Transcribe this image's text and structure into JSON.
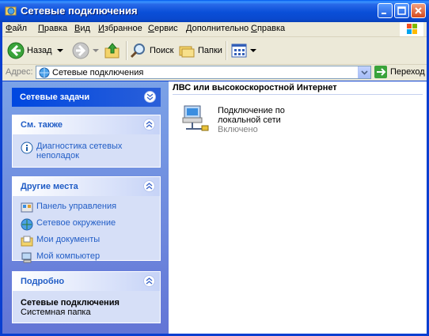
{
  "window": {
    "title": "Сетевые подключения"
  },
  "menu": [
    "Файл",
    "Правка",
    "Вид",
    "Избранное",
    "Сервис",
    "Дополнительно",
    "Справка"
  ],
  "toolbar": {
    "back": "Назад",
    "search": "Поиск",
    "folders": "Папки"
  },
  "address": {
    "label": "Адрес:",
    "value": "Сетевые подключения",
    "go": "Переход"
  },
  "tasks": {
    "network_tasks": {
      "title": "Сетевые задачи"
    },
    "see_also": {
      "title": "См. также",
      "links": [
        "Диагностика сетевых неполадок"
      ]
    },
    "other_places": {
      "title": "Другие места",
      "links": [
        "Панель управления",
        "Сетевое окружение",
        "Мои документы",
        "Мой компьютер"
      ]
    },
    "details": {
      "title": "Подробно",
      "name": "Сетевые подключения",
      "type": "Системная папка"
    }
  },
  "content": {
    "group": "ЛВС или высокоскоростной Интернет",
    "connection": {
      "name": "Подключение по локальной сети",
      "status": "Включено"
    }
  },
  "colors": {
    "taskpane_top": "#7ba2e7",
    "taskpane_bottom": "#6375d6",
    "link": "#215dc6",
    "titlebar": "#0a4fd8"
  }
}
